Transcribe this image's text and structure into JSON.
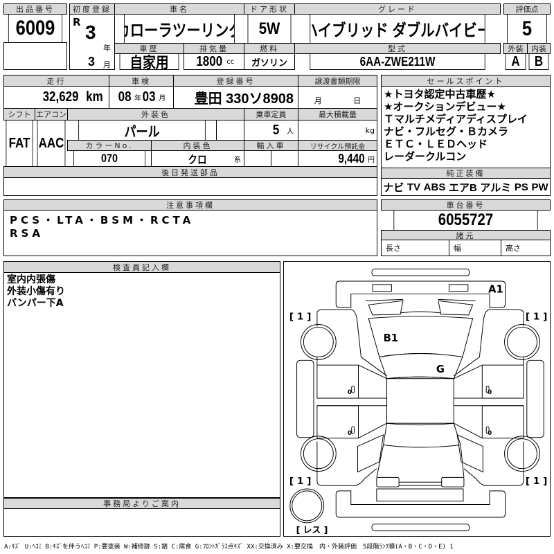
{
  "lot": {
    "label": "出品番号",
    "value": "6009"
  },
  "first_reg": {
    "label": "初度登録",
    "era": "R",
    "year": "3",
    "year_unit": "年",
    "month": "3",
    "month_unit": "月"
  },
  "car_name": {
    "label": "車名",
    "value": "カローラツーリング"
  },
  "door": {
    "label": "ドア形状",
    "value": "5W"
  },
  "grade": {
    "label": "グレード",
    "value": "ハイブリッド ダブルバイビー"
  },
  "history": {
    "label": "車歴",
    "value": "自家用"
  },
  "displacement": {
    "label": "排気量",
    "value": "1800",
    "unit": "cc"
  },
  "fuel": {
    "label": "燃料",
    "value": "ガソリン"
  },
  "model": {
    "label": "型式",
    "value": "6AA-ZWE211W"
  },
  "score": {
    "label": "評価点",
    "value": "5",
    "ext_label": "外装",
    "ext": "A",
    "int_label": "内装",
    "int": "B"
  },
  "mileage": {
    "label": "走行",
    "value": "32,629",
    "unit": "km"
  },
  "inspection": {
    "label": "車検",
    "year": "08",
    "year_unit": "年",
    "month": "03",
    "month_unit": "月"
  },
  "plate": {
    "label": "登録番号",
    "value": "豊田 330ソ8908"
  },
  "transfer": {
    "label": "譲渡書類期限",
    "month_unit": "月",
    "day_unit": "日"
  },
  "shift": {
    "label": "シフト",
    "value": "FAT"
  },
  "aircon": {
    "label": "エアコン",
    "value": "AAC"
  },
  "ext_color": {
    "label": "外装色",
    "value": "パール"
  },
  "capacity": {
    "label": "乗車定員",
    "value": "5",
    "unit": "人"
  },
  "max_load": {
    "label": "最大積載量",
    "unit": "kg"
  },
  "color_no": {
    "label": "カラーNo.",
    "value": "070"
  },
  "int_color": {
    "label": "内装色",
    "value": "クロ",
    "unit": "系"
  },
  "import": {
    "label": "輸入車"
  },
  "recycle": {
    "label": "リサイクル預託金",
    "value": "9,440",
    "unit": "円"
  },
  "later_parts": {
    "label": "後日発送部品"
  },
  "sales_points": {
    "label": "セールスポイント",
    "lines": [
      "★トヨタ認定中古車歴★",
      "★オークションデビュー★",
      "Ｔマルチメディアディスプレイ",
      "ナビ・フルセグ・Ｂカメラ",
      "ＥＴＣ・ＬＥＤヘッド",
      "レーダークルコン"
    ]
  },
  "equipment": {
    "label": "純正装備",
    "items": [
      "ナビ",
      "TV",
      "ABS",
      "エアB",
      "アルミ",
      "PS",
      "PW"
    ]
  },
  "notes": {
    "label": "注意事項欄",
    "lines": [
      "PCS・LTA・BSM・RCTA",
      "RSA"
    ]
  },
  "chassis": {
    "label": "車台番号",
    "value": "6055727",
    "spec_label": "諸元",
    "length": "長さ",
    "width": "幅",
    "height": "高さ"
  },
  "inspector": {
    "label": "検査員記入欄",
    "lines": [
      "室内内張傷",
      "外装小傷有り",
      "バンパー下A"
    ]
  },
  "office": {
    "label": "事務局よりご案内"
  },
  "diagram": {
    "marks": {
      "front_bumper": "A1",
      "hood": "B1",
      "windshield": "G"
    },
    "tire_fl": "[ 1 ]",
    "tire_fr": "[ 1 ]",
    "tire_rl": "[ 1 ]",
    "tire_rr": "[ 1 ]",
    "door_marks": [
      "0",
      "0",
      "0",
      "0"
    ],
    "spare": "[ レス ]"
  },
  "legend": "A:ｷｽﾞ U:ﾍｺﾐ B:ｷｽﾞを伴うﾍｺﾐ P:要塗装 W:補修跡 S:錆 C:腐食 G:ﾌﾛﾝﾄｶﾞﾗｽ点ｷｽﾞ XX:交換済み X:要交換　内・外装評価　5段階ﾗﾝｸ順(A・B・C・D・E) 1"
}
